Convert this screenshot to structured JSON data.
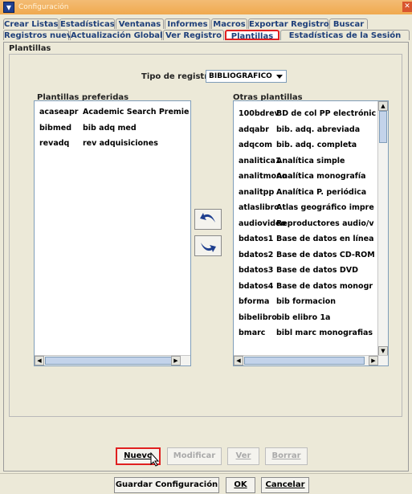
{
  "window": {
    "title": "Configuración"
  },
  "tabs_row1": [
    "Crear Listas",
    "Estadísticas",
    "Ventanas",
    "Informes",
    "Macros",
    "Exportar Registros",
    "Buscar"
  ],
  "tabs_row2": [
    "Registros nuevos",
    "Actualización Global",
    "Ver Registro",
    "Plantillas",
    "Estadísticas de la Sesión"
  ],
  "active_tab": "Plantillas",
  "group": {
    "title": "Plantillas"
  },
  "record_type": {
    "label": "Tipo de registro",
    "value": "BIBLIOGRAFICO"
  },
  "preferred": {
    "header": "Plantillas preferidas",
    "items": [
      {
        "code": "acaseapr",
        "name": "Academic Search Premie"
      },
      {
        "code": "bibmed",
        "name": "bib adq med"
      },
      {
        "code": "revadq",
        "name": "rev adquisiciones"
      }
    ]
  },
  "other": {
    "header": "Otras plantillas",
    "items": [
      {
        "code": "100bdrev",
        "name": "BD de col PP electrónic"
      },
      {
        "code": "adqabr",
        "name": "bib. adq. abreviada"
      },
      {
        "code": "adqcom",
        "name": "bib. adq. completa"
      },
      {
        "code": "analitica1",
        "name": "Analítica simple"
      },
      {
        "code": "analitmono",
        "name": "Analítica monografía"
      },
      {
        "code": "analitpp",
        "name": "Analítica P. periódica"
      },
      {
        "code": "atlaslibro",
        "name": "Atlas geográfico impre"
      },
      {
        "code": "audiovideo",
        "name": "Reproductores audio/v"
      },
      {
        "code": "bdatos1",
        "name": "Base de datos en línea"
      },
      {
        "code": "bdatos2",
        "name": "Base de datos CD-ROM"
      },
      {
        "code": "bdatos3",
        "name": "Base de datos DVD"
      },
      {
        "code": "bdatos4",
        "name": "Base de datos monogr"
      },
      {
        "code": "bforma",
        "name": "bib formacion"
      },
      {
        "code": "bibelibro",
        "name": "bib elibro 1a"
      },
      {
        "code": "bmarc",
        "name": "bibl marc monografias"
      }
    ]
  },
  "actions": {
    "new": "Nuevo",
    "modify": "Modificar",
    "view": "Ver",
    "delete": "Borrar"
  },
  "footer": {
    "save": "Guardar Configuración",
    "ok": "OK",
    "cancel": "Cancelar"
  },
  "colors": {
    "highlight": "#e02020",
    "titlebar": "#f0a94f",
    "tab_text": "#1e3f7a"
  },
  "icons": [
    "move-left-icon",
    "move-right-icon"
  ]
}
